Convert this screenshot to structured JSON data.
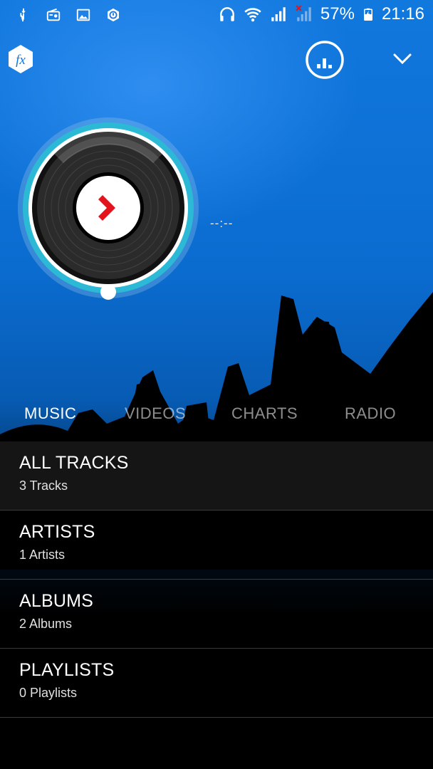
{
  "status_bar": {
    "left_icons": [
      "usb-icon",
      "radio-icon",
      "image-icon",
      "sync-icon"
    ],
    "right_icons": [
      "headphones-icon",
      "wifi-icon",
      "signal-icon",
      "signal-no-sim-icon",
      "battery-charging-icon"
    ],
    "battery": "57%",
    "time": "21:16"
  },
  "header": {
    "fx_label": "fx",
    "icons": [
      "fx-icon",
      "equalizer-icon",
      "chevron-down-icon"
    ]
  },
  "player": {
    "time_display": "--:--",
    "icon": "play-icon",
    "accent": "#2bb9d6",
    "play_color": "#e3141b"
  },
  "tabs": [
    {
      "label": "MUSIC",
      "active": true
    },
    {
      "label": "VIDEOS",
      "active": false
    },
    {
      "label": "CHARTS",
      "active": false
    },
    {
      "label": "RADIO",
      "active": false
    }
  ],
  "library": [
    {
      "title": "ALL TRACKS",
      "subtitle": "3 Tracks"
    },
    {
      "title": "ARTISTS",
      "subtitle": "1 Artists"
    },
    {
      "title": "ALBUMS",
      "subtitle": "2 Albums"
    },
    {
      "title": "PLAYLISTS",
      "subtitle": "0 Playlists"
    }
  ]
}
